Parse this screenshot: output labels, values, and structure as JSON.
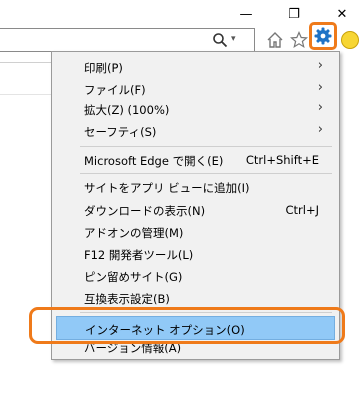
{
  "window": {
    "minimize_glyph": "—",
    "restore_glyph": "❐",
    "close_glyph": "✕"
  },
  "toolbar": {
    "search_dropdown_glyph": "▾",
    "icons": [
      "search-icon",
      "home-icon",
      "star-icon",
      "gear-icon",
      "smiley-icon"
    ],
    "accent": "#ef7a1a",
    "gear_color": "#1f73c6"
  },
  "menu": {
    "arrow": "›",
    "items": [
      {
        "label": "印刷(P)",
        "submenu": true
      },
      {
        "label": "ファイル(F)",
        "submenu": true
      },
      {
        "label": "拡大(Z) (100%)",
        "submenu": true
      },
      {
        "label": "セーフティ(S)",
        "submenu": true
      },
      {
        "label": "Microsoft Edge で開く(E)",
        "shortcut": "Ctrl+Shift+E"
      },
      {
        "label": "サイトをアプリ ビューに追加(I)"
      },
      {
        "label": "ダウンロードの表示(N)",
        "shortcut": "Ctrl+J"
      },
      {
        "label": "アドオンの管理(M)"
      },
      {
        "label": "F12 開発者ツール(L)"
      },
      {
        "label": "ピン留めサイト(G)"
      },
      {
        "label": "互換表示設定(B)"
      },
      {
        "label": "インターネット オプション(O)",
        "highlighted": true
      },
      {
        "label": "バージョン情報(A)"
      }
    ],
    "highlight_color": "#91c9f7"
  }
}
